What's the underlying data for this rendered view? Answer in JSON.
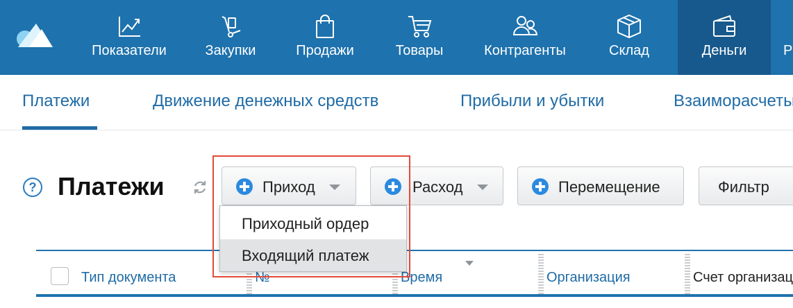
{
  "nav": {
    "items": [
      {
        "label": "Показатели",
        "icon": "chart-line-icon"
      },
      {
        "label": "Закупки",
        "icon": "hand-truck-icon"
      },
      {
        "label": "Продажи",
        "icon": "shopping-bag-icon"
      },
      {
        "label": "Товары",
        "icon": "shopping-cart-icon"
      },
      {
        "label": "Контрагенты",
        "icon": "users-icon"
      },
      {
        "label": "Склад",
        "icon": "box-icon"
      },
      {
        "label": "Деньги",
        "icon": "wallet-icon"
      }
    ],
    "active": "Деньги",
    "accent": "#1e72ad",
    "active_bg": "#17598c"
  },
  "subtabs": {
    "items": [
      "Платежи",
      "Движение денежных средств",
      "Прибыли и убытки",
      "Взаиморасчеты"
    ],
    "active": "Платежи"
  },
  "page": {
    "title": "Платежи"
  },
  "toolbar": {
    "income_label": "Приход",
    "expense_label": "Расход",
    "transfer_label": "Перемещение",
    "filter_label": "Фильтр"
  },
  "income_menu": {
    "items": [
      "Приходный ордер",
      "Входящий платеж"
    ],
    "hovered": "Входящий платеж"
  },
  "table": {
    "columns": [
      "Тип документа",
      "№",
      "Время",
      "Организация",
      "Счет организации"
    ]
  }
}
